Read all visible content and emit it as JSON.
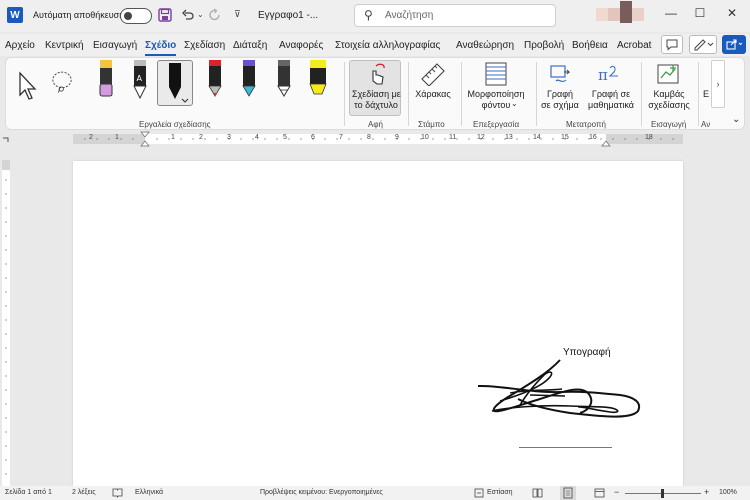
{
  "titlebar": {
    "autosave_label": "Αυτόματη αποθήκευση",
    "doc_title": "Εγγραφο1  -...",
    "search_placeholder": "Αναζήτηση",
    "word_logo": "W"
  },
  "menu": {
    "tabs": [
      "Αρχείο",
      "Κεντρική",
      "Εισαγωγή",
      "Σχέδιο",
      "Σχεδίαση",
      "Διάταξη",
      "Αναφορές",
      "Στοιχεία αλληλογραφίας",
      "Αναθεώρηση",
      "Προβολή",
      "Βοήθεια",
      "Acrobat"
    ],
    "active_tab": "Σχέδιο"
  },
  "ribbon": {
    "groups": {
      "drawing_tools": "Εργαλεία σχεδίασης",
      "touch": "Αφή",
      "stencils": "Στάμπο",
      "edit": "Επεξεργασία",
      "convert": "Μετατροπή",
      "insert": "Εισαγωγή",
      "partial": "Αν"
    },
    "draw_with_finger_line1": "Σχεδίαση με",
    "draw_with_finger_line2": "το δάχτυλο",
    "ruler": "Χάρακας",
    "background_format_line1": "Μορφοποίηση",
    "background_format_line2": "φόντου",
    "ink_to_shape_line1": "Γραφή",
    "ink_to_shape_line2": "σε σχήμα",
    "ink_to_math_line1": "Γραφή σε",
    "ink_to_math_line2": "μαθηματικά",
    "drawing_canvas_line1": "Καμβάς",
    "drawing_canvas_line2": "σχεδίασης",
    "partial_e": "Ε"
  },
  "ruler_numbers": [
    "2",
    "1",
    "1",
    "2",
    "3",
    "4",
    "5",
    "6",
    "7",
    "8",
    "9",
    "10",
    "11",
    "12",
    "13",
    "14",
    "15",
    "16",
    "18"
  ],
  "document": {
    "signature_label": "Υπογραφή"
  },
  "status": {
    "page": "Σελίδα 1 από 1",
    "words": "2 λέξεις",
    "language": "Ελληνικά",
    "predictions": "Προβλέψεις κειμένου: Ενεργοποιημένες",
    "focus": "Εστίαση",
    "zoom": "100%"
  },
  "colors": {
    "accent": "#185abd",
    "ribbon_bg": "#fafafa",
    "window_bg": "#efefef"
  }
}
